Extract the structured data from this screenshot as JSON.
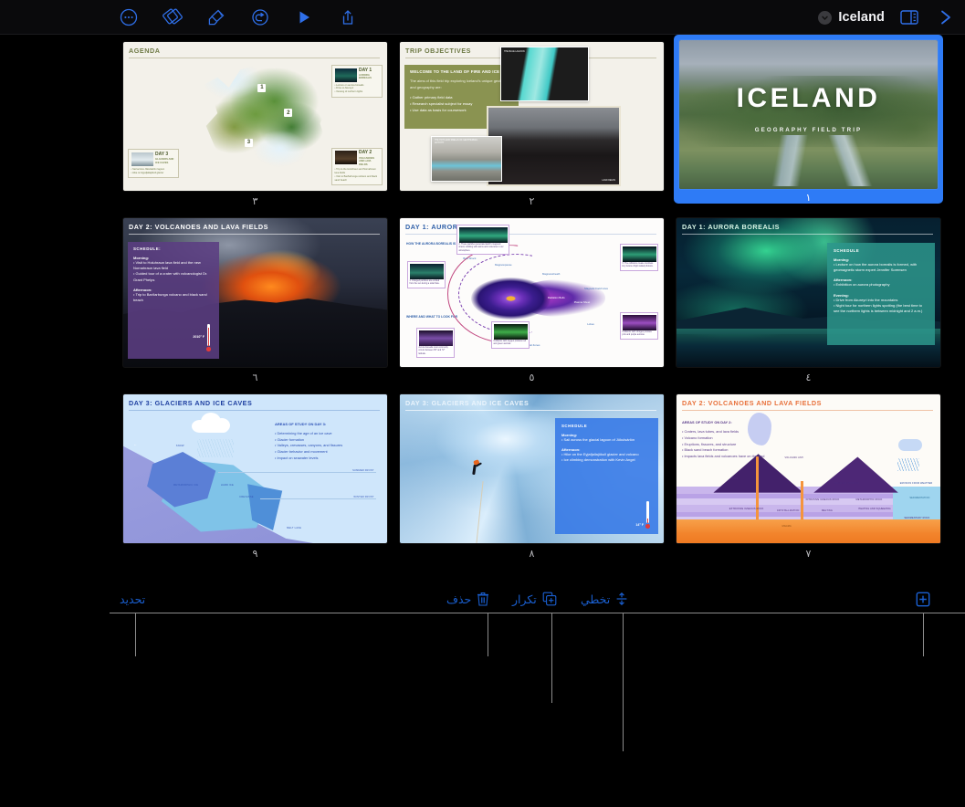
{
  "app": {
    "document_title": "Iceland",
    "accent_color": "#2e7bf6",
    "annotation_color": "#1a5fd0",
    "background": "#000000"
  },
  "toolbar": {
    "left_items": [
      {
        "name": "more-options-icon",
        "label": "…"
      },
      {
        "name": "navigator-icon",
        "label": "Navigator"
      },
      {
        "name": "format-brush-icon",
        "label": "Format"
      },
      {
        "name": "animate-icon",
        "label": "Animate"
      },
      {
        "name": "play-icon",
        "label": "Play"
      },
      {
        "name": "share-icon",
        "label": "Share"
      }
    ],
    "right_items": [
      {
        "name": "document-title",
        "label": "Iceland"
      },
      {
        "name": "view-options-icon",
        "label": "View"
      },
      {
        "name": "next-icon",
        "label": ">"
      }
    ]
  },
  "annotations": {
    "items": [
      {
        "label": "تحديد",
        "icon": "",
        "name": "annotation-select"
      },
      {
        "label": "حذف",
        "icon": "trash-icon",
        "name": "annotation-delete"
      },
      {
        "label": "تكرار",
        "icon": "duplicate-icon",
        "name": "annotation-duplicate"
      },
      {
        "label": "تخطي",
        "icon": "skip-icon",
        "name": "annotation-skip"
      },
      {
        "label": "",
        "icon": "add-icon",
        "name": "annotation-add-slide"
      }
    ]
  },
  "slides": [
    {
      "number": "٣",
      "selected": false,
      "title": "AGENDA",
      "kind": "agenda",
      "map_numbers": [
        "1",
        "2",
        "3"
      ],
      "cards": [
        {
          "day": "DAY 1",
          "subject": "AURORA\nBOREALIS",
          "bullets": [
            "• Lecture on aurora borealis",
            "• Drive to Akureyri",
            "• Viewing of northern lights"
          ]
        },
        {
          "day": "DAY 2",
          "subject": "VOLCANOES\nAND LAVA FIELDS",
          "bullets": [
            "• Trip to the Holuhraun and Nornahraun lava fields",
            "• Visit to Barðarbunga volcano and black sand beach"
          ]
        },
        {
          "day": "DAY 3",
          "subject": "GLACIERS AND\nICE CAVES",
          "bullets": [
            "• Sail across Jökulsárlón lagoon",
            "• Hike on Eyjafjallajökull glacier"
          ]
        }
      ]
    },
    {
      "number": "٢",
      "selected": false,
      "title": "TRIP OBJECTIVES",
      "kind": "objectives",
      "box_heading": "WELCOME TO THE LAND OF FIRE AND ICE",
      "box_paragraph": "The aims of this field trip exploring Iceland's unique geology and geography are:",
      "box_bullets": [
        "• Gather primary field data",
        "• Research specialist subject for essay",
        "• Use data as basis for coursework"
      ],
      "photo_captions": [
        "THE BLUE LAGOON",
        "THE HOTS AND SMELLS OF GEOTHERMAL ACTIVITY",
        "LAVA FIELDS"
      ]
    },
    {
      "number": "١",
      "selected": true,
      "title": "ICELAND",
      "kind": "cover",
      "subtitle": "GEOGRAPHY FIELD TRIP"
    },
    {
      "number": "٦",
      "selected": false,
      "title": "DAY 2: VOLCANOES AND LAVA FIELDS",
      "kind": "volcano-photo",
      "schedule_heading": "SCHEDULE:",
      "blocks": [
        {
          "label": "Morning:",
          "items": [
            "• Visit to Holuhraun lava field and the new Nornahraun lava field",
            "• Guided tour of a crater with volcanologist Dr. Grant Phelps"
          ]
        },
        {
          "label": "Afternoon:",
          "items": [
            "• Trip to Barðarbunga volcano and black sand beach"
          ]
        }
      ],
      "temperature": "2010° F"
    },
    {
      "number": "٥",
      "selected": false,
      "title": "DAY 1: AURORA BOREALIS",
      "kind": "aurora-diagram",
      "subhead_1": "HOW THE AURORA BOREALIS IS FORMED",
      "subhead_2": "WHERE AND WHAT TO LOOK FOR",
      "diagram_labels": [
        "Bow Shock",
        "Magnetopause",
        "Magnetosheath",
        "Magnetic Field Lines",
        "Plasma Sheet",
        "Radiation Belts",
        "Auroral Zones",
        "Lobes",
        "Solar Wind"
      ],
      "captions": [
        "1. Charged particles are emitted from the sun during a solar flare.",
        "2. These particles penetrate Earth's magnetic shield, colliding with atoms and molecules in our atmosphere.",
        "3. The collisions create countless tiny bursts of light called photons.",
        "Aurora borealis most commonly occurs between 65° and 72° latitude.",
        "Collisions with oxygen produce red and green auroras.",
        "Collisions with nitrogen produce pink and purple auroras."
      ]
    },
    {
      "number": "٤",
      "selected": false,
      "title": "DAY 1: AURORA BOREALIS",
      "kind": "aurora-photo",
      "schedule_heading": "SCHEDULE",
      "blocks": [
        {
          "label": "Morning:",
          "items": [
            "• Lecture on how the aurora borealis is formed, with geomagnetic storm expert Jennifer Sorensen"
          ]
        },
        {
          "label": "Afternoon:",
          "items": [
            "• Exhibition on aurora photography"
          ]
        },
        {
          "label": "Evening:",
          "items": [
            "• Drive from Akureyri into the mountains",
            "• Night tour for northern lights spotting (the best time to see the northern lights is between midnight and 2 a.m.)"
          ]
        }
      ]
    },
    {
      "number": "٩",
      "selected": false,
      "title": "DAY 3: GLACIERS AND ICE CAVES",
      "kind": "glacier-diagram",
      "areas_heading": "AREAS OF STUDY ON DAY 3:",
      "areas": [
        "• Determining the age of an ice cave",
        "• Glacier formation",
        "• Valleys, crevasses, canyons, and fissures",
        "• Glacier behavior and movement",
        "• Impact on seawater levels"
      ],
      "diagram_labels": [
        "SNOW",
        "FIRN",
        "METAMORPHIC ICE",
        "HARD ICE",
        "CREVASSE",
        "SUMMER FROST",
        "WINTER FROST",
        "MELT LAKE"
      ]
    },
    {
      "number": "٨",
      "selected": false,
      "title": "DAY 3: GLACIERS AND ICE CAVES",
      "kind": "ice-climb",
      "schedule_heading": "SCHEDULE",
      "blocks": [
        {
          "label": "Morning:",
          "items": [
            "• Sail across the glacial lagoon of Jökulsárlón"
          ]
        },
        {
          "label": "Afternoon:",
          "items": [
            "• Hike on the Eyjafjallajökull glacier and volcano",
            "• Ice climbing demonstration with Kevin Angel"
          ]
        }
      ],
      "temperature": "14° F"
    },
    {
      "number": "٧",
      "selected": false,
      "title": "DAY 2: VOLCANOES AND LAVA FIELDS",
      "kind": "volcano-diagram",
      "areas_heading": "AREAS OF STUDY ON DAY 2:",
      "areas": [
        "• Craters, lava tubes, and lava fields",
        "• Volcano formation",
        "• Eruptions, fissures, and structure",
        "• Black sand beach formation",
        "• Impacts lava fields and volcanoes have on the land"
      ],
      "diagram_labels": [
        "VOLCANIC ASH",
        "LAVA",
        "MAGMA",
        "UPLIFTED SURFACE",
        "INTRUSIVE IGNEOUS ROCK",
        "EXTRUSIVE IGNEOUS ROCK",
        "METAMORPHIC ROCK",
        "SEDIMENTARY ROCK",
        "CRYSTALLIZATION",
        "MELTING",
        "HEATING AND SQUEEZING",
        "EROSION FROM WEATHER",
        "SEDIMENTATION"
      ]
    }
  ]
}
